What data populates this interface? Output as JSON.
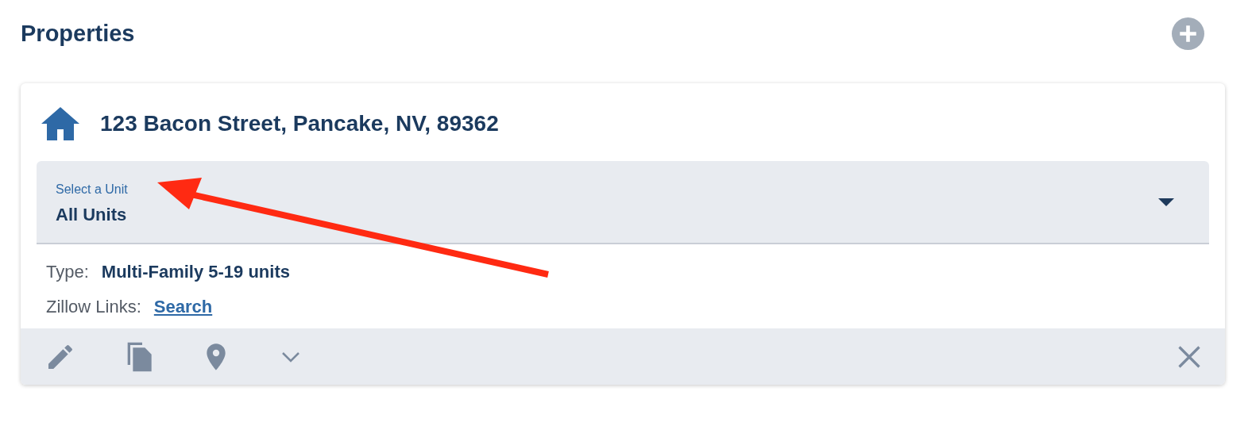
{
  "header": {
    "title": "Properties"
  },
  "property": {
    "address": "123 Bacon Street, Pancake, NV, 89362",
    "unit_select": {
      "label": "Select a Unit",
      "value": "All Units"
    },
    "details": [
      {
        "label": "Type:",
        "value": "Multi-Family 5-19 units",
        "kind": "text"
      },
      {
        "label": "Zillow Links:",
        "value": "Search",
        "kind": "link"
      }
    ]
  }
}
